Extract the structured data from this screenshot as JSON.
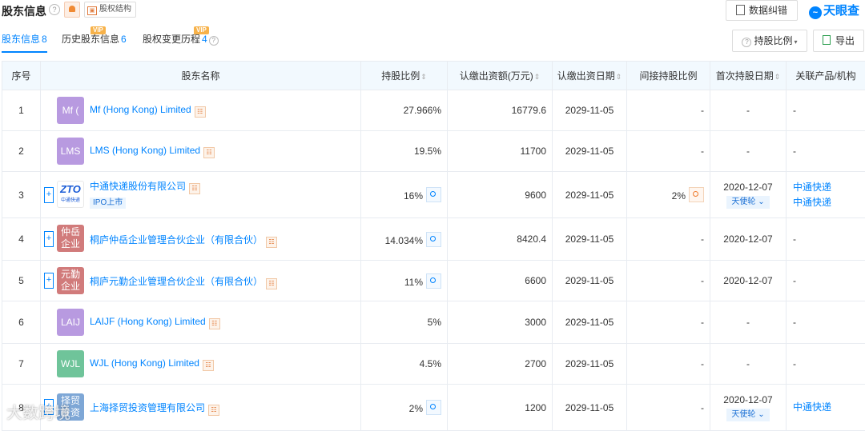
{
  "header": {
    "title": "股东信息",
    "equity_button": "股权结构",
    "error_button": "数据纠错",
    "logo_text": "天眼查"
  },
  "tabs": [
    {
      "label": "股东信息",
      "count": "8",
      "vip": ""
    },
    {
      "label": "历史股东信息",
      "count": "6",
      "vip": "VIP"
    },
    {
      "label": "股权变更历程",
      "count": "4",
      "vip": "VIP"
    }
  ],
  "toolbar": {
    "sort_label": "持股比例",
    "export_label": "导出"
  },
  "table": {
    "headers": [
      "序号",
      "股东名称",
      "持股比例",
      "认缴出资额(万元)",
      "认缴出资日期",
      "间接持股比例",
      "首次持股日期",
      "关联产品/机构"
    ],
    "rows": [
      {
        "no": "1",
        "avatar": "Mf (",
        "name": "Mf (Hong Kong) Limited",
        "ratio": "27.966%",
        "amount": "16779.6",
        "date": "2029-11-05",
        "indirect": "-",
        "first": "-",
        "related": "-"
      },
      {
        "no": "2",
        "avatar": "LMS",
        "name": "LMS (Hong Kong) Limited",
        "ratio": "19.5%",
        "amount": "11700",
        "date": "2029-11-05",
        "indirect": "-",
        "first": "-",
        "related": "-"
      },
      {
        "no": "3",
        "avatar": "ZTO",
        "avatar_sub": "中通快递",
        "name": "中通快递股份有限公司",
        "ipo": "IPO上市",
        "ratio": "16%",
        "amount": "9600",
        "date": "2029-11-05",
        "indirect": "2%",
        "first": "2020-12-07",
        "round": "天使轮",
        "related1": "中通快递",
        "related2": "中通快递"
      },
      {
        "no": "4",
        "avatar_l1": "仲岳",
        "avatar_l2": "企业",
        "name": "桐庐仲岳企业管理合伙企业（有限合伙）",
        "ratio": "14.034%",
        "amount": "8420.4",
        "date": "2029-11-05",
        "indirect": "-",
        "first": "2020-12-07",
        "related": "-"
      },
      {
        "no": "5",
        "avatar_l1": "元勤",
        "avatar_l2": "企业",
        "name": "桐庐元勤企业管理合伙企业（有限合伙）",
        "ratio": "11%",
        "amount": "6600",
        "date": "2029-11-05",
        "indirect": "-",
        "first": "2020-12-07",
        "related": "-"
      },
      {
        "no": "6",
        "avatar": "LAIJ",
        "name": "LAIJF (Hong Kong) Limited",
        "ratio": "5%",
        "amount": "3000",
        "date": "2029-11-05",
        "indirect": "-",
        "first": "-",
        "related": "-"
      },
      {
        "no": "7",
        "avatar": "WJL",
        "name": "WJL (Hong Kong) Limited",
        "ratio": "4.5%",
        "amount": "2700",
        "date": "2029-11-05",
        "indirect": "-",
        "first": "-",
        "related": "-"
      },
      {
        "no": "8",
        "avatar_l1": "择贸",
        "avatar_l2": "投资",
        "name": "上海择贸投资管理有限公司",
        "ratio": "2%",
        "amount": "1200",
        "date": "2029-11-05",
        "indirect": "-",
        "first": "2020-12-07",
        "round": "天使轮",
        "related": "中通快递"
      }
    ]
  },
  "watermark": "大数跨境",
  "colors": {
    "accent": "#0084ff",
    "vip": "#f7b24a",
    "header_bg": "#f2f9fe"
  }
}
